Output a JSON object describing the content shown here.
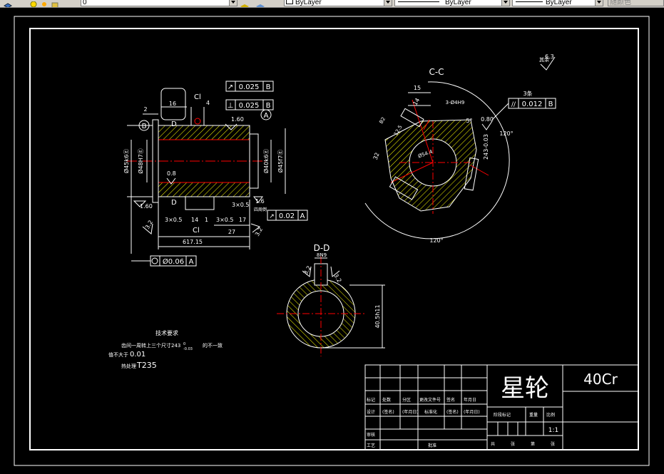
{
  "toolbar": {
    "layer_value": "0",
    "color_value": "ByLayer",
    "linetype_value": "ByLayer",
    "lineweight_value": "ByLayer",
    "plotstyle_value": "随颜色"
  },
  "drawing": {
    "section_cc": "C-C",
    "section_dd": "D-D",
    "part_name": "星轮",
    "material": "40Cr",
    "scale": "1:1",
    "tech_req": {
      "title": "技术要求",
      "line1": "齿间一周转上三个尺寸243",
      "line1_tol_upper": "0",
      "line1_tol_lower": "-0.03",
      "line1_end": "的不一致",
      "line2_prefix": "值不大于",
      "line2_val": "0.01",
      "line3_prefix": "热处理",
      "line3_val": "T235"
    },
    "left_view": {
      "fcf_runout_sym": "↗",
      "fcf_runout_val": "0.025",
      "fcf_runout_ref": "B",
      "fcf_perp_sym": "⊥",
      "fcf_perp_val": "0.025",
      "fcf_perp_ref": "B",
      "fcf_runout2_val": "0.02",
      "fcf_runout2_ref": "A",
      "fcf_conc_val": "Ø0.06",
      "fcf_conc_ref": "A",
      "datum_a": "A",
      "datum_b": "B",
      "dim_16": "16",
      "dim_2": "2",
      "dim_4": "4",
      "label_cl_top": "Cl",
      "label_cl_bottom": "Cl",
      "label_d_top": "D",
      "label_d_bottom": "D",
      "dim_d48": "Ø48H7Ⓔ",
      "dim_d45": "Ø45k6Ⓔ",
      "dim_d40": "Ø40k6Ⓔ",
      "dim_d45f": "Ø45f7Ⓔ",
      "rough_160_top": "1.60",
      "rough_08": "0.8",
      "rough_160_bottom": "1.60",
      "rough_16": "1.6",
      "rough_32_left": "3.2",
      "rough_32_right": "3.2",
      "dim_3x05_a": "3×0.5",
      "dim_14": "14",
      "dim_1": "1",
      "dim_3x05_b": "3×0.5",
      "dim_3x05_c": "3×0.5",
      "dim_17": "17",
      "dim_27": "27",
      "dim_617": "617.15",
      "small_label": "四周倒"
    },
    "cc_view": {
      "rough_label": "其余",
      "rough_val": "6.3",
      "dim_15": "15",
      "dim_14": "14",
      "dim_holes": "3-Ø4H9",
      "dim_5deg": "5°",
      "dim_080": "0.80",
      "fcf_count": "3条",
      "fcf_par_val": "0.012",
      "fcf_par_ref": "B",
      "dim_120_right": "120°",
      "dim_243": "243-0.03",
      "dim_32": "32",
      "dim_d54": "Ø54.4",
      "dim_b2": "B2",
      "dim_125": "12.5",
      "dim_120_bottom": "120°"
    },
    "dd_view": {
      "dim_8n9": "8N9",
      "rough_32_left": "3.2",
      "rough_32_right": "3.2",
      "dim_405": "40.5h11"
    },
    "title_block": {
      "r1": [
        "标记",
        "处数",
        "分区",
        "更改文件号",
        "签名",
        "年月日"
      ],
      "r2": [
        "设计",
        "(签名)",
        "(年月日)",
        "标准化",
        "(签名)",
        "(年月日)"
      ],
      "r3": [
        "审核"
      ],
      "r4": [
        "工艺",
        "批准"
      ],
      "stage_label": "阶段标记",
      "weight_label": "重量",
      "scale_label": "比例",
      "footer": [
        "共",
        "张",
        "第",
        "张"
      ]
    }
  },
  "colors": {
    "line_white": "#ffffff",
    "center_red": "#ff0000",
    "hatch_yellow": "#ffff00",
    "bg": "#000000"
  }
}
